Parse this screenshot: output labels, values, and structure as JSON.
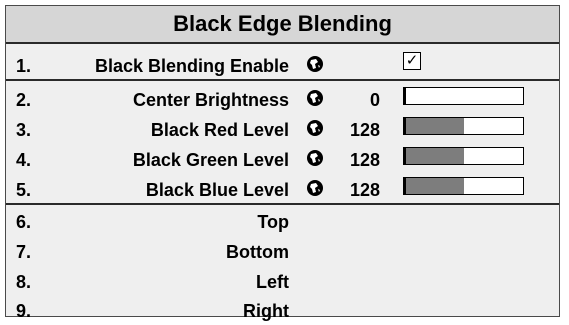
{
  "menu": {
    "title": "Black Edge Blending",
    "rows": [
      {
        "num": "1.",
        "label": "Black Blending Enable",
        "globe": true,
        "control": "checkbox",
        "checked": true,
        "check_mark": "✓"
      },
      {
        "num": "2.",
        "label": "Center Brightness",
        "globe": true,
        "value": "0",
        "control": "slider",
        "level": 0.0
      },
      {
        "num": "3.",
        "label": "Black Red Level",
        "globe": true,
        "value": "128",
        "control": "slider",
        "level": 0.5
      },
      {
        "num": "4.",
        "label": "Black Green Level",
        "globe": true,
        "value": "128",
        "control": "slider",
        "level": 0.5
      },
      {
        "num": "5.",
        "label": "Black Blue Level",
        "globe": true,
        "value": "128",
        "control": "slider",
        "level": 0.5
      },
      {
        "num": "6.",
        "label": "Top"
      },
      {
        "num": "7.",
        "label": "Bottom"
      },
      {
        "num": "8.",
        "label": "Left"
      },
      {
        "num": "9.",
        "label": "Right"
      }
    ]
  },
  "icons": {
    "globe": "globe-icon",
    "check": "checkmark-icon"
  },
  "colors": {
    "panel": "#efefef",
    "title_bar": "#d6d6d6",
    "slider_fill": "#7d7d7d"
  }
}
